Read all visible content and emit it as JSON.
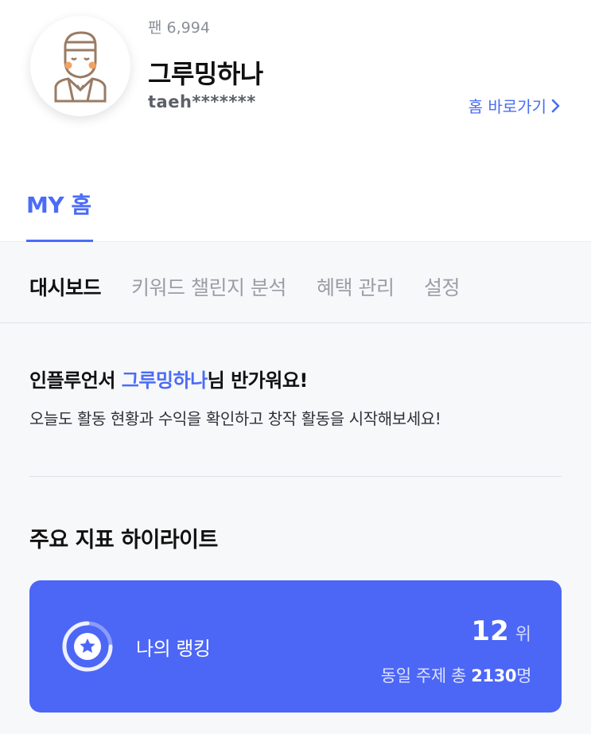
{
  "profile": {
    "fan_label": "팬",
    "fan_count": "6,994",
    "nickname": "그루밍하나",
    "user_id": "taeh*******",
    "home_link_label": "홈 바로가기",
    "avatar_icon": "person-avatar-icon"
  },
  "tabs": {
    "my_home": "MY 홈"
  },
  "subnav": {
    "items": [
      "대시보드",
      "키워드 챌린지 분석",
      "혜택 관리",
      "설정"
    ],
    "active": "대시보드"
  },
  "welcome": {
    "prefix": "인플루언서 ",
    "name": "그루밍하나",
    "suffix": "님 반가워요!",
    "subtitle": "오늘도 활동 현황과 수익을 확인하고 창작 활동을 시작해보세요!"
  },
  "highlights": {
    "title": "주요 지표 하이라이트",
    "ranking": {
      "label": "나의 랭킹",
      "rank": "12",
      "unit": "위",
      "total_prefix": "동일 주제 총 ",
      "total_count": "2130",
      "total_suffix": "명",
      "icon": "star-ranking-icon"
    }
  },
  "colors": {
    "accent": "#4a6cf7",
    "card_bg": "#4c66f6",
    "page_gray": "#f7f8fa"
  }
}
